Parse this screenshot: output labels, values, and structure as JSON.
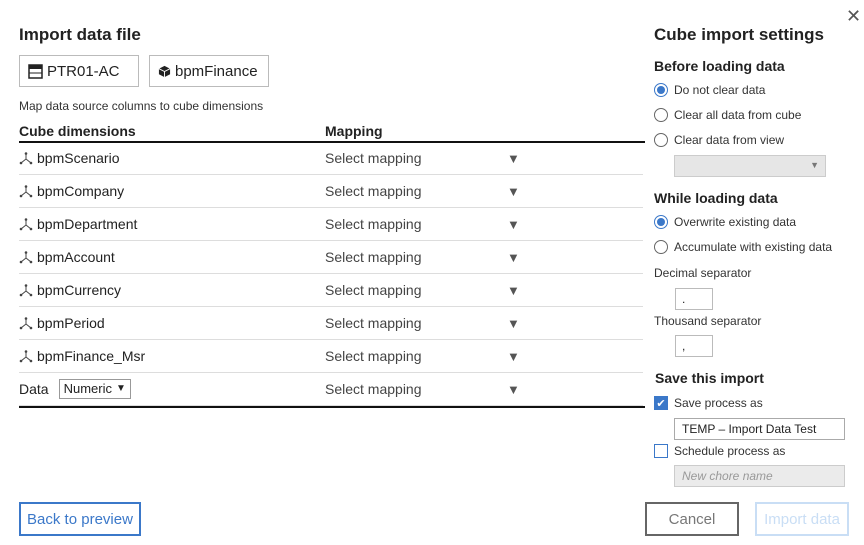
{
  "left": {
    "title": "Import data file",
    "source_chip": {
      "label": "PTR01-AC",
      "icon": "table-icon"
    },
    "cube_chip": {
      "label": "bpmFinance",
      "icon": "cube-icon"
    },
    "instruction": "Map data source columns to cube dimensions",
    "columns": {
      "dimensions": "Cube dimensions",
      "mapping": "Mapping"
    },
    "rows": [
      {
        "dimension": "bpmScenario",
        "mapping": "Select mapping"
      },
      {
        "dimension": "bpmCompany",
        "mapping": "Select mapping"
      },
      {
        "dimension": "bpmDepartment",
        "mapping": "Select mapping"
      },
      {
        "dimension": "bpmAccount",
        "mapping": "Select mapping"
      },
      {
        "dimension": "bpmCurrency",
        "mapping": "Select mapping"
      },
      {
        "dimension": "bpmPeriod",
        "mapping": "Select mapping"
      },
      {
        "dimension": "bpmFinance_Msr",
        "mapping": "Select mapping"
      }
    ],
    "data_row": {
      "label": "Data",
      "type_value": "Numeric",
      "mapping": "Select mapping"
    },
    "back_button": "Back to preview"
  },
  "right": {
    "title": "Cube import settings",
    "close_icon": "close-icon",
    "before": {
      "heading": "Before loading data",
      "options": [
        "Do not clear data",
        "Clear all data from cube",
        "Clear data from view"
      ],
      "selected": 0
    },
    "while": {
      "heading": "While loading data",
      "options": [
        "Overwrite existing data",
        "Accumulate with existing data"
      ],
      "selected": 0
    },
    "decimal": {
      "label": "Decimal separator",
      "value": "."
    },
    "thousand": {
      "label": "Thousand separator",
      "value": ","
    },
    "save": {
      "heading": "Save this import",
      "save_process_label": "Save process as",
      "save_process_checked": true,
      "save_process_value": "TEMP – Import Data Test",
      "schedule_label": "Schedule process as",
      "schedule_checked": false,
      "schedule_placeholder": "New chore name"
    },
    "cancel_button": "Cancel",
    "import_button": "Import data"
  },
  "colors": {
    "accent": "#3b78c9",
    "disabled": "#c9def5"
  }
}
